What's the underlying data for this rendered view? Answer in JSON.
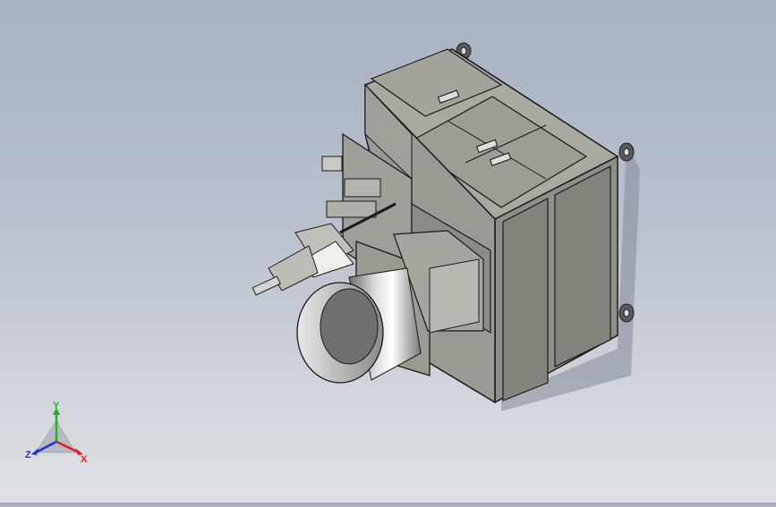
{
  "viewport": {
    "background_top": "#a7b1c2",
    "background_bottom": "#dfe1e4",
    "model_color": "#8e8e86"
  },
  "triad": {
    "x_label": "X",
    "y_label": "Y",
    "z_label": "Z",
    "x_color": "#e02020",
    "y_color": "#20b020",
    "z_color": "#2030e0"
  }
}
